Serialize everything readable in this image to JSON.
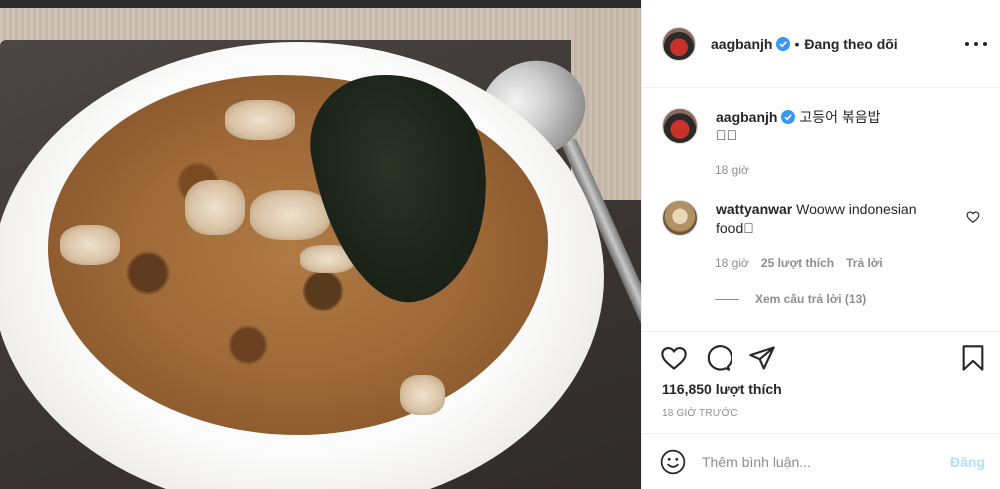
{
  "post": {
    "author": "aagbanjh",
    "header_separator": "•",
    "follow_status": "Đang theo dõi",
    "caption_text": "고등어 볶음밥",
    "caption_emoji": "􏿾􏿾",
    "caption_time": "18 giờ"
  },
  "comment": {
    "username": "wattyanwar",
    "text": "Wooww indonesian food􏿾",
    "time": "18 giờ",
    "likes": "25 lượt thích",
    "reply_label": "Trả lời",
    "view_replies": "Xem câu trả lời (13)"
  },
  "stats": {
    "likes": "116,850 lượt thích",
    "posted_ago": "18 GIỜ TRƯỚC"
  },
  "composer": {
    "placeholder": "Thêm bình luận...",
    "post_label": "Đăng"
  },
  "colors": {
    "verified": "#3897f0",
    "muted": "#8e8e8e",
    "post_disabled": "#b2dffc"
  },
  "icons": [
    "heart-icon",
    "comment-icon",
    "share-icon",
    "bookmark-icon",
    "emoji-icon",
    "more-options-icon",
    "verified-badge-icon"
  ]
}
